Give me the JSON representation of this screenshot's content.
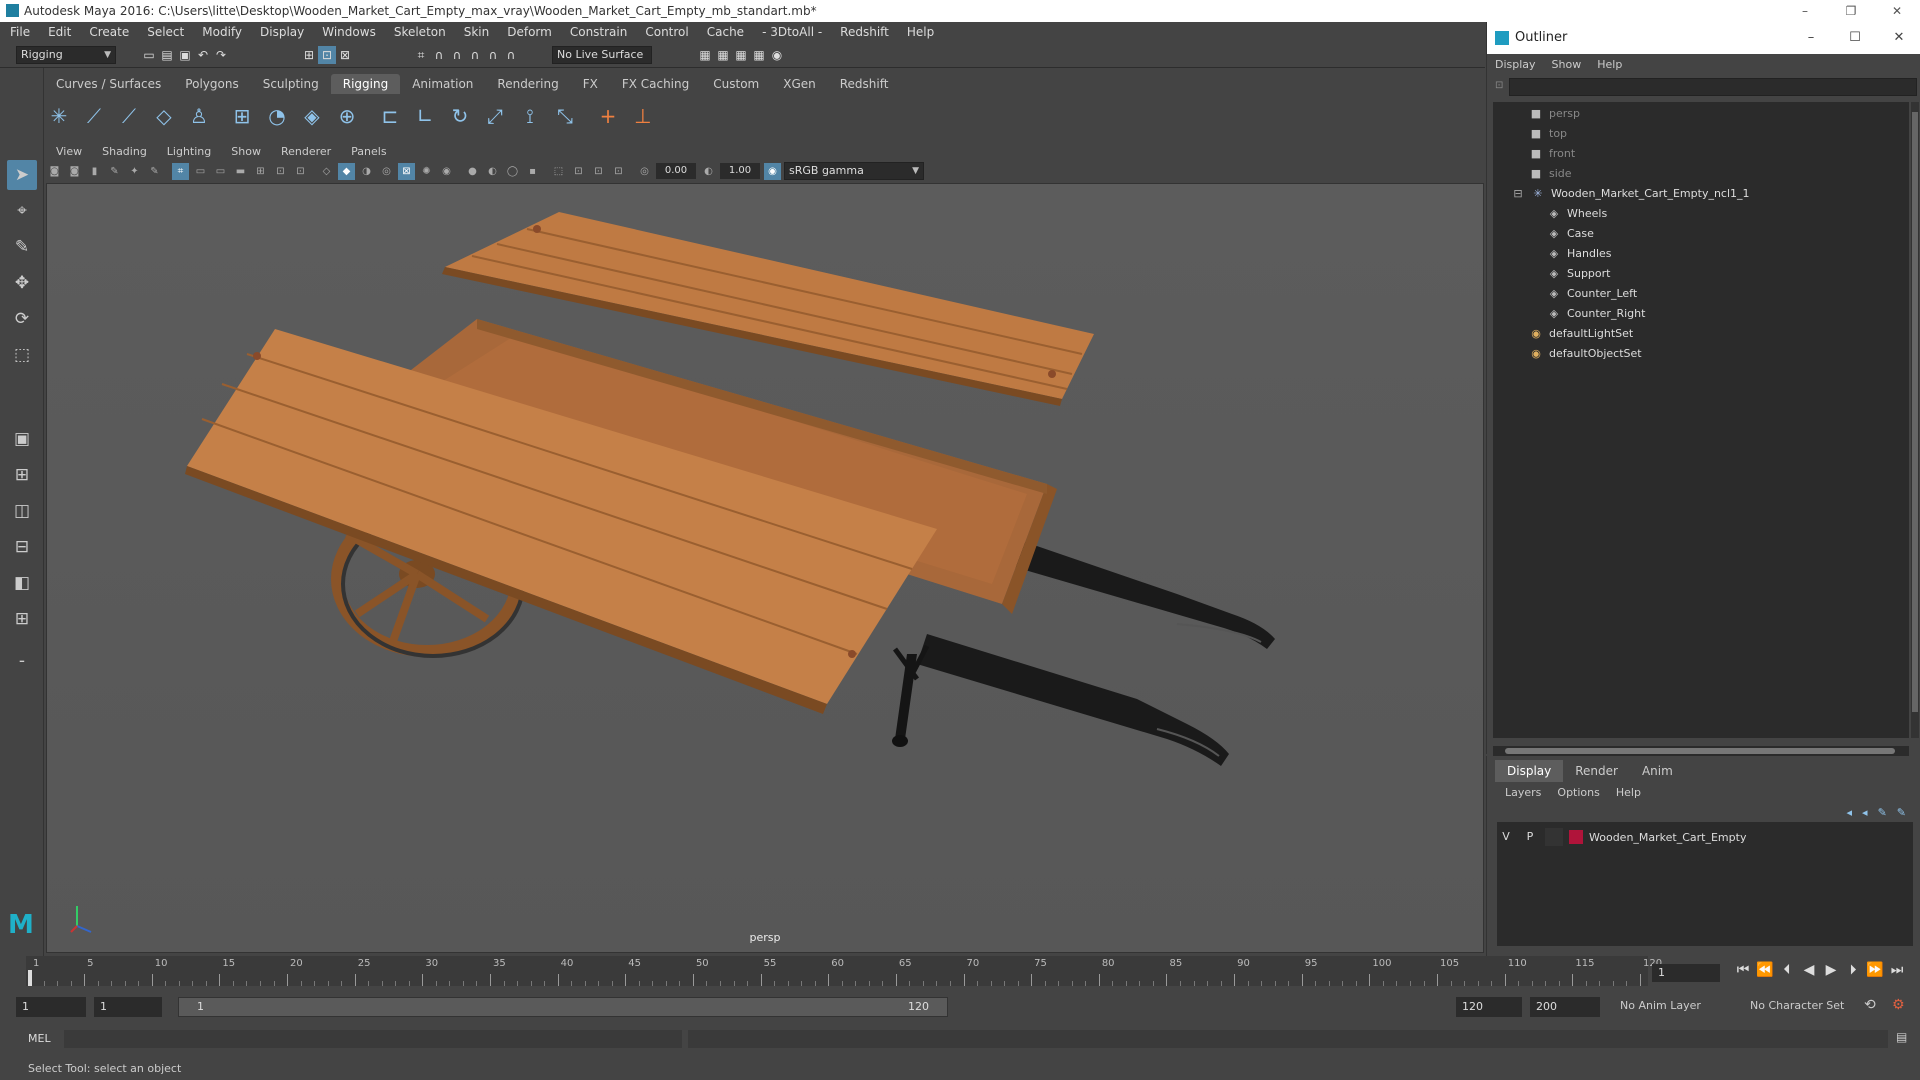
{
  "window": {
    "title": "Autodesk Maya 2016: C:\\Users\\litte\\Desktop\\Wooden_Market_Cart_Empty_max_vray\\Wooden_Market_Cart_Empty_mb_standart.mb*",
    "controls": [
      "–",
      "❐",
      "✕"
    ]
  },
  "menubar": [
    "File",
    "Edit",
    "Create",
    "Select",
    "Modify",
    "Display",
    "Windows",
    "Skeleton",
    "Skin",
    "Deform",
    "Constrain",
    "Control",
    "Cache",
    "- 3DtoAll -",
    "Redshift",
    "Help"
  ],
  "statusline": {
    "mode": "Rigging",
    "live_surface": "No Live Surface"
  },
  "shelf": {
    "tabs": [
      "Curves / Surfaces",
      "Polygons",
      "Sculpting",
      "Rigging",
      "Animation",
      "Rendering",
      "FX",
      "FX Caching",
      "Custom",
      "XGen",
      "Redshift"
    ],
    "active_tab": "Rigging"
  },
  "panel": {
    "menu": [
      "View",
      "Shading",
      "Lighting",
      "Show",
      "Renderer",
      "Panels"
    ],
    "exposure": "0.00",
    "gamma": "1.00",
    "color_space": "sRGB gamma",
    "camera_label": "persp"
  },
  "outliner": {
    "title": "Outliner",
    "window_controls": [
      "–",
      "☐",
      "✕"
    ],
    "menu": [
      "Display",
      "Show",
      "Help"
    ],
    "items": [
      {
        "label": "persp",
        "icon": "camera-icon",
        "dim": true,
        "indent": 1
      },
      {
        "label": "top",
        "icon": "camera-icon",
        "dim": true,
        "indent": 1
      },
      {
        "label": "front",
        "icon": "camera-icon",
        "dim": true,
        "indent": 1
      },
      {
        "label": "side",
        "icon": "camera-icon",
        "dim": true,
        "indent": 1
      },
      {
        "label": "Wooden_Market_Cart_Empty_ncl1_1",
        "icon": "group-icon",
        "dim": false,
        "indent": 0
      },
      {
        "label": "Wheels",
        "icon": "mesh-icon",
        "dim": false,
        "indent": 2
      },
      {
        "label": "Case",
        "icon": "mesh-icon",
        "dim": false,
        "indent": 2
      },
      {
        "label": "Handles",
        "icon": "mesh-icon",
        "dim": false,
        "indent": 2
      },
      {
        "label": "Support",
        "icon": "mesh-icon",
        "dim": false,
        "indent": 2
      },
      {
        "label": "Counter_Left",
        "icon": "mesh-icon",
        "dim": false,
        "indent": 2
      },
      {
        "label": "Counter_Right",
        "icon": "mesh-icon",
        "dim": false,
        "indent": 2
      },
      {
        "label": "defaultLightSet",
        "icon": "set-icon",
        "dim": false,
        "indent": 1
      },
      {
        "label": "defaultObjectSet",
        "icon": "set-icon",
        "dim": false,
        "indent": 1
      }
    ]
  },
  "layers": {
    "tabs": [
      "Display",
      "Render",
      "Anim"
    ],
    "active_tab": "Display",
    "menu": [
      "Layers",
      "Options",
      "Help"
    ],
    "rows": [
      {
        "v": "V",
        "p": "P",
        "color": "#b0143a",
        "name": "Wooden_Market_Cart_Empty"
      }
    ]
  },
  "timeline": {
    "ticks": [
      1,
      5,
      10,
      15,
      20,
      25,
      30,
      35,
      40,
      45,
      50,
      55,
      60,
      65,
      70,
      75,
      80,
      85,
      90,
      95,
      100,
      105,
      110,
      115,
      120
    ],
    "min": 1,
    "max": 120,
    "current_frame": "1"
  },
  "range": {
    "start": "1",
    "playback_start": "1",
    "slider_start": "1",
    "slider_end": "120",
    "playback_end": "120",
    "end": "200",
    "anim_layer": "No Anim Layer",
    "character_set": "No Character Set"
  },
  "cmd": {
    "label": "MEL"
  },
  "status": {
    "message": "Select Tool: select an object"
  }
}
